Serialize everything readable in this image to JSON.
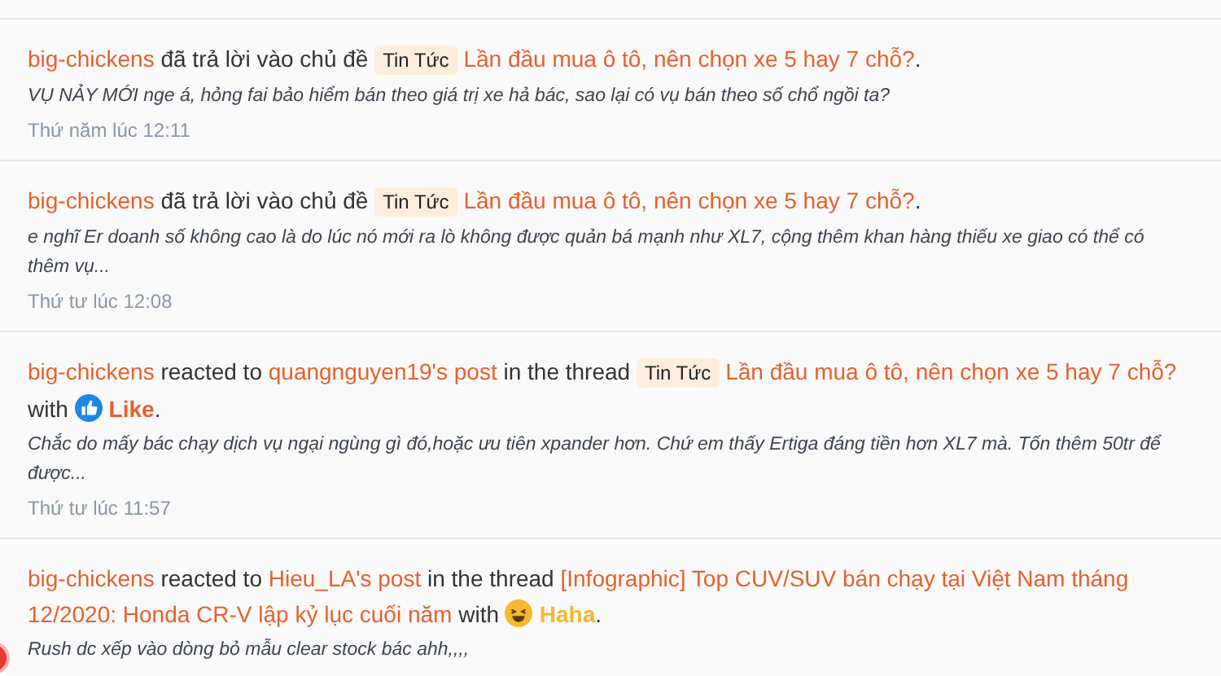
{
  "activities": [
    {
      "segments": [
        {
          "kind": "link",
          "text": "big-chickens"
        },
        {
          "kind": "text",
          "text": "đã trả lời vào chủ đề"
        },
        {
          "kind": "tag",
          "text": "Tin Tức"
        },
        {
          "kind": "link",
          "text": "Lần đầu mua ô tô, nên chọn xe 5 hay 7 chỗ?"
        },
        {
          "kind": "text",
          "text": "."
        }
      ],
      "snippet": "VỤ NẢY MỚI nge á, hỏng fai bảo hiểm bán theo giá trị xe hả bác, sao lại có vụ bán theo số chổ ngồi ta?",
      "time": "Thứ năm lúc 12:11"
    },
    {
      "segments": [
        {
          "kind": "link",
          "text": "big-chickens"
        },
        {
          "kind": "text",
          "text": "đã trả lời vào chủ đề"
        },
        {
          "kind": "tag",
          "text": "Tin Tức"
        },
        {
          "kind": "link",
          "text": "Lần đầu mua ô tô, nên chọn xe 5 hay 7 chỗ?"
        },
        {
          "kind": "text",
          "text": "."
        }
      ],
      "snippet": "e nghĩ Er doanh số không cao là do lúc nó mới ra lò không được quản bá mạnh như XL7, cộng thêm khan hàng thiếu xe giao có thể có thêm vụ...",
      "time": "Thứ tư lúc 12:08"
    },
    {
      "segments": [
        {
          "kind": "link",
          "text": "big-chickens"
        },
        {
          "kind": "text",
          "text": "reacted to"
        },
        {
          "kind": "link",
          "text": "quangnguyen19's post"
        },
        {
          "kind": "text",
          "text": "in the thread"
        },
        {
          "kind": "tag",
          "text": "Tin Tức"
        },
        {
          "kind": "link",
          "text": "Lần đầu mua ô tô, nên chọn xe 5 hay 7 chỗ?"
        },
        {
          "kind": "text",
          "text": "with"
        },
        {
          "kind": "like",
          "text": "Like"
        },
        {
          "kind": "text",
          "text": "."
        }
      ],
      "snippet": "Chắc do mấy bác chạy dịch vụ ngại ngùng gì đó,hoặc ưu tiên xpander hơn. Chứ em thấy Ertiga đáng tiền hơn XL7 mà. Tốn thêm 50tr để được...",
      "time": "Thứ tư lúc 11:57"
    },
    {
      "segments": [
        {
          "kind": "link",
          "text": "big-chickens"
        },
        {
          "kind": "text",
          "text": "reacted to"
        },
        {
          "kind": "link",
          "text": "Hieu_LA's post"
        },
        {
          "kind": "text",
          "text": "in the thread"
        },
        {
          "kind": "link",
          "text": "[Infographic] Top CUV/SUV bán chạy tại Việt Nam tháng"
        },
        {
          "kind": "link",
          "text": "12/2020: Honda CR-V lập kỷ lục cuối năm"
        },
        {
          "kind": "text",
          "text": "with"
        },
        {
          "kind": "haha",
          "text": "Haha"
        },
        {
          "kind": "text",
          "text": "."
        }
      ],
      "snippet": "Rush dc xếp vào dòng bỏ mẫu clear stock bác ahh,,,,"
    }
  ]
}
